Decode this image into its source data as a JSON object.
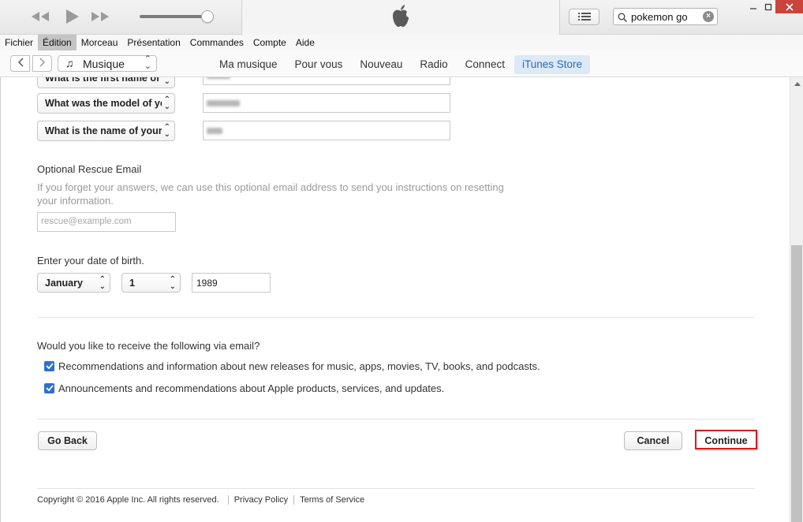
{
  "player": {
    "search_value": "pokemon go",
    "volume_fraction": 0.92
  },
  "menu": [
    "Fichier",
    "Édition",
    "Morceau",
    "Présentation",
    "Commandes",
    "Compte",
    "Aide"
  ],
  "nav": {
    "media_label": "Musique",
    "tabs": [
      "Ma musique",
      "Pour vous",
      "Nouveau",
      "Radio",
      "Connect",
      "iTunes Store"
    ],
    "active_tab": "iTunes Store"
  },
  "security": {
    "questions": [
      "What is the first name of your best friend in high school?",
      "What was the model of your first car?",
      "What is the name of your favorite children's book?"
    ]
  },
  "rescue": {
    "title": "Optional Rescue Email",
    "hint": "If you forget your answers, we can use this optional email address to send you instructions on resetting your information.",
    "placeholder": "rescue@example.com"
  },
  "dob": {
    "title": "Enter your date of birth.",
    "month": "January",
    "day": "1",
    "year": "1989"
  },
  "email_prefs": {
    "question": "Would you like to receive the following via email?",
    "options": [
      "Recommendations and information about new releases for music, apps, movies, TV, books, and podcasts.",
      "Announcements and recommendations about Apple products, services, and updates."
    ]
  },
  "buttons": {
    "go_back": "Go Back",
    "cancel": "Cancel",
    "continue": "Continue"
  },
  "footer": {
    "copyright": "Copyright © 2016 Apple Inc. All rights reserved.",
    "privacy": "Privacy Policy",
    "terms": "Terms of Service"
  },
  "colors": {
    "accent_blue": "#2e6fd0",
    "active_tab_bg": "#dce9f7",
    "highlight_red": "#d21e1e"
  },
  "icons": [
    "rewind-icon",
    "play-icon",
    "fast-forward-icon",
    "apple-logo-icon",
    "list-view-icon",
    "search-icon",
    "clear-search-icon",
    "music-note-icon",
    "chevron-left-icon",
    "chevron-right-icon"
  ]
}
